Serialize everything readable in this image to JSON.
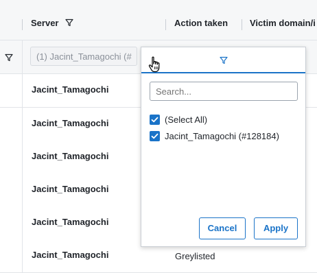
{
  "grid": {
    "columns": {
      "server": "Server",
      "action_taken": "Action taken",
      "victim_domain": "Victim domain/i"
    },
    "server_filter_value": "(1) Jacint_Tamagochi (#",
    "rows": [
      {
        "server": "Jacint_Tamagochi",
        "action": ""
      },
      {
        "server": "Jacint_Tamagochi",
        "action": ""
      },
      {
        "server": "Jacint_Tamagochi",
        "action": ""
      },
      {
        "server": "Jacint_Tamagochi",
        "action": ""
      },
      {
        "server": "Jacint_Tamagochi",
        "action": ""
      },
      {
        "server": "Jacint_Tamagochi",
        "action": "Greylisted"
      }
    ]
  },
  "filter_popup": {
    "search_placeholder": "Search...",
    "options": [
      {
        "label": "(Select All)",
        "checked": true
      },
      {
        "label": "Jacint_Tamagochi (#128184)",
        "checked": true
      }
    ],
    "cancel_label": "Cancel",
    "apply_label": "Apply"
  },
  "colors": {
    "accent": "#1a73c8",
    "header_bg": "#f6f7f8",
    "border": "#e1e4e8"
  },
  "icons": [
    "filter-icon",
    "checkbox-checked-icon",
    "hand-cursor-icon"
  ]
}
